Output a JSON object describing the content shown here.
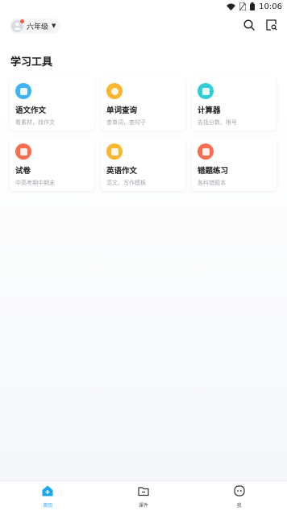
{
  "status_bar": {
    "time": "10:06",
    "icons": [
      "wifi-icon",
      "sim-icon",
      "battery-icon"
    ]
  },
  "header": {
    "grade_label": "六年级",
    "actions": [
      "search-icon",
      "scan-icon"
    ]
  },
  "section": {
    "title": "学习工具"
  },
  "tools": [
    {
      "title": "语文作文",
      "subtitle": "看素材，找作文",
      "color": "#3fb4f5",
      "icon": "document-icon"
    },
    {
      "title": "单词查询",
      "subtitle": "查单词，查句子",
      "color": "#f9b62e",
      "icon": "word-icon"
    },
    {
      "title": "计算器",
      "subtitle": "去括分数、根号",
      "color": "#2fcfd7",
      "icon": "calculator-icon"
    },
    {
      "title": "试卷",
      "subtitle": "中高考期中期末",
      "color": "#f86c4f",
      "icon": "exam-icon"
    },
    {
      "title": "英语作文",
      "subtitle": "范文、写作模板",
      "color": "#f9b62e",
      "icon": "english-icon"
    },
    {
      "title": "错题练习",
      "subtitle": "各科错题本",
      "color": "#f86c4f",
      "icon": "mistake-icon"
    }
  ],
  "bottom_nav": {
    "active_color": "#1aa8f2",
    "items": [
      {
        "label": "首页",
        "icon": "home-icon"
      },
      {
        "label": "课件",
        "icon": "folder-icon"
      },
      {
        "label": "我",
        "icon": "profile-icon"
      }
    ]
  }
}
